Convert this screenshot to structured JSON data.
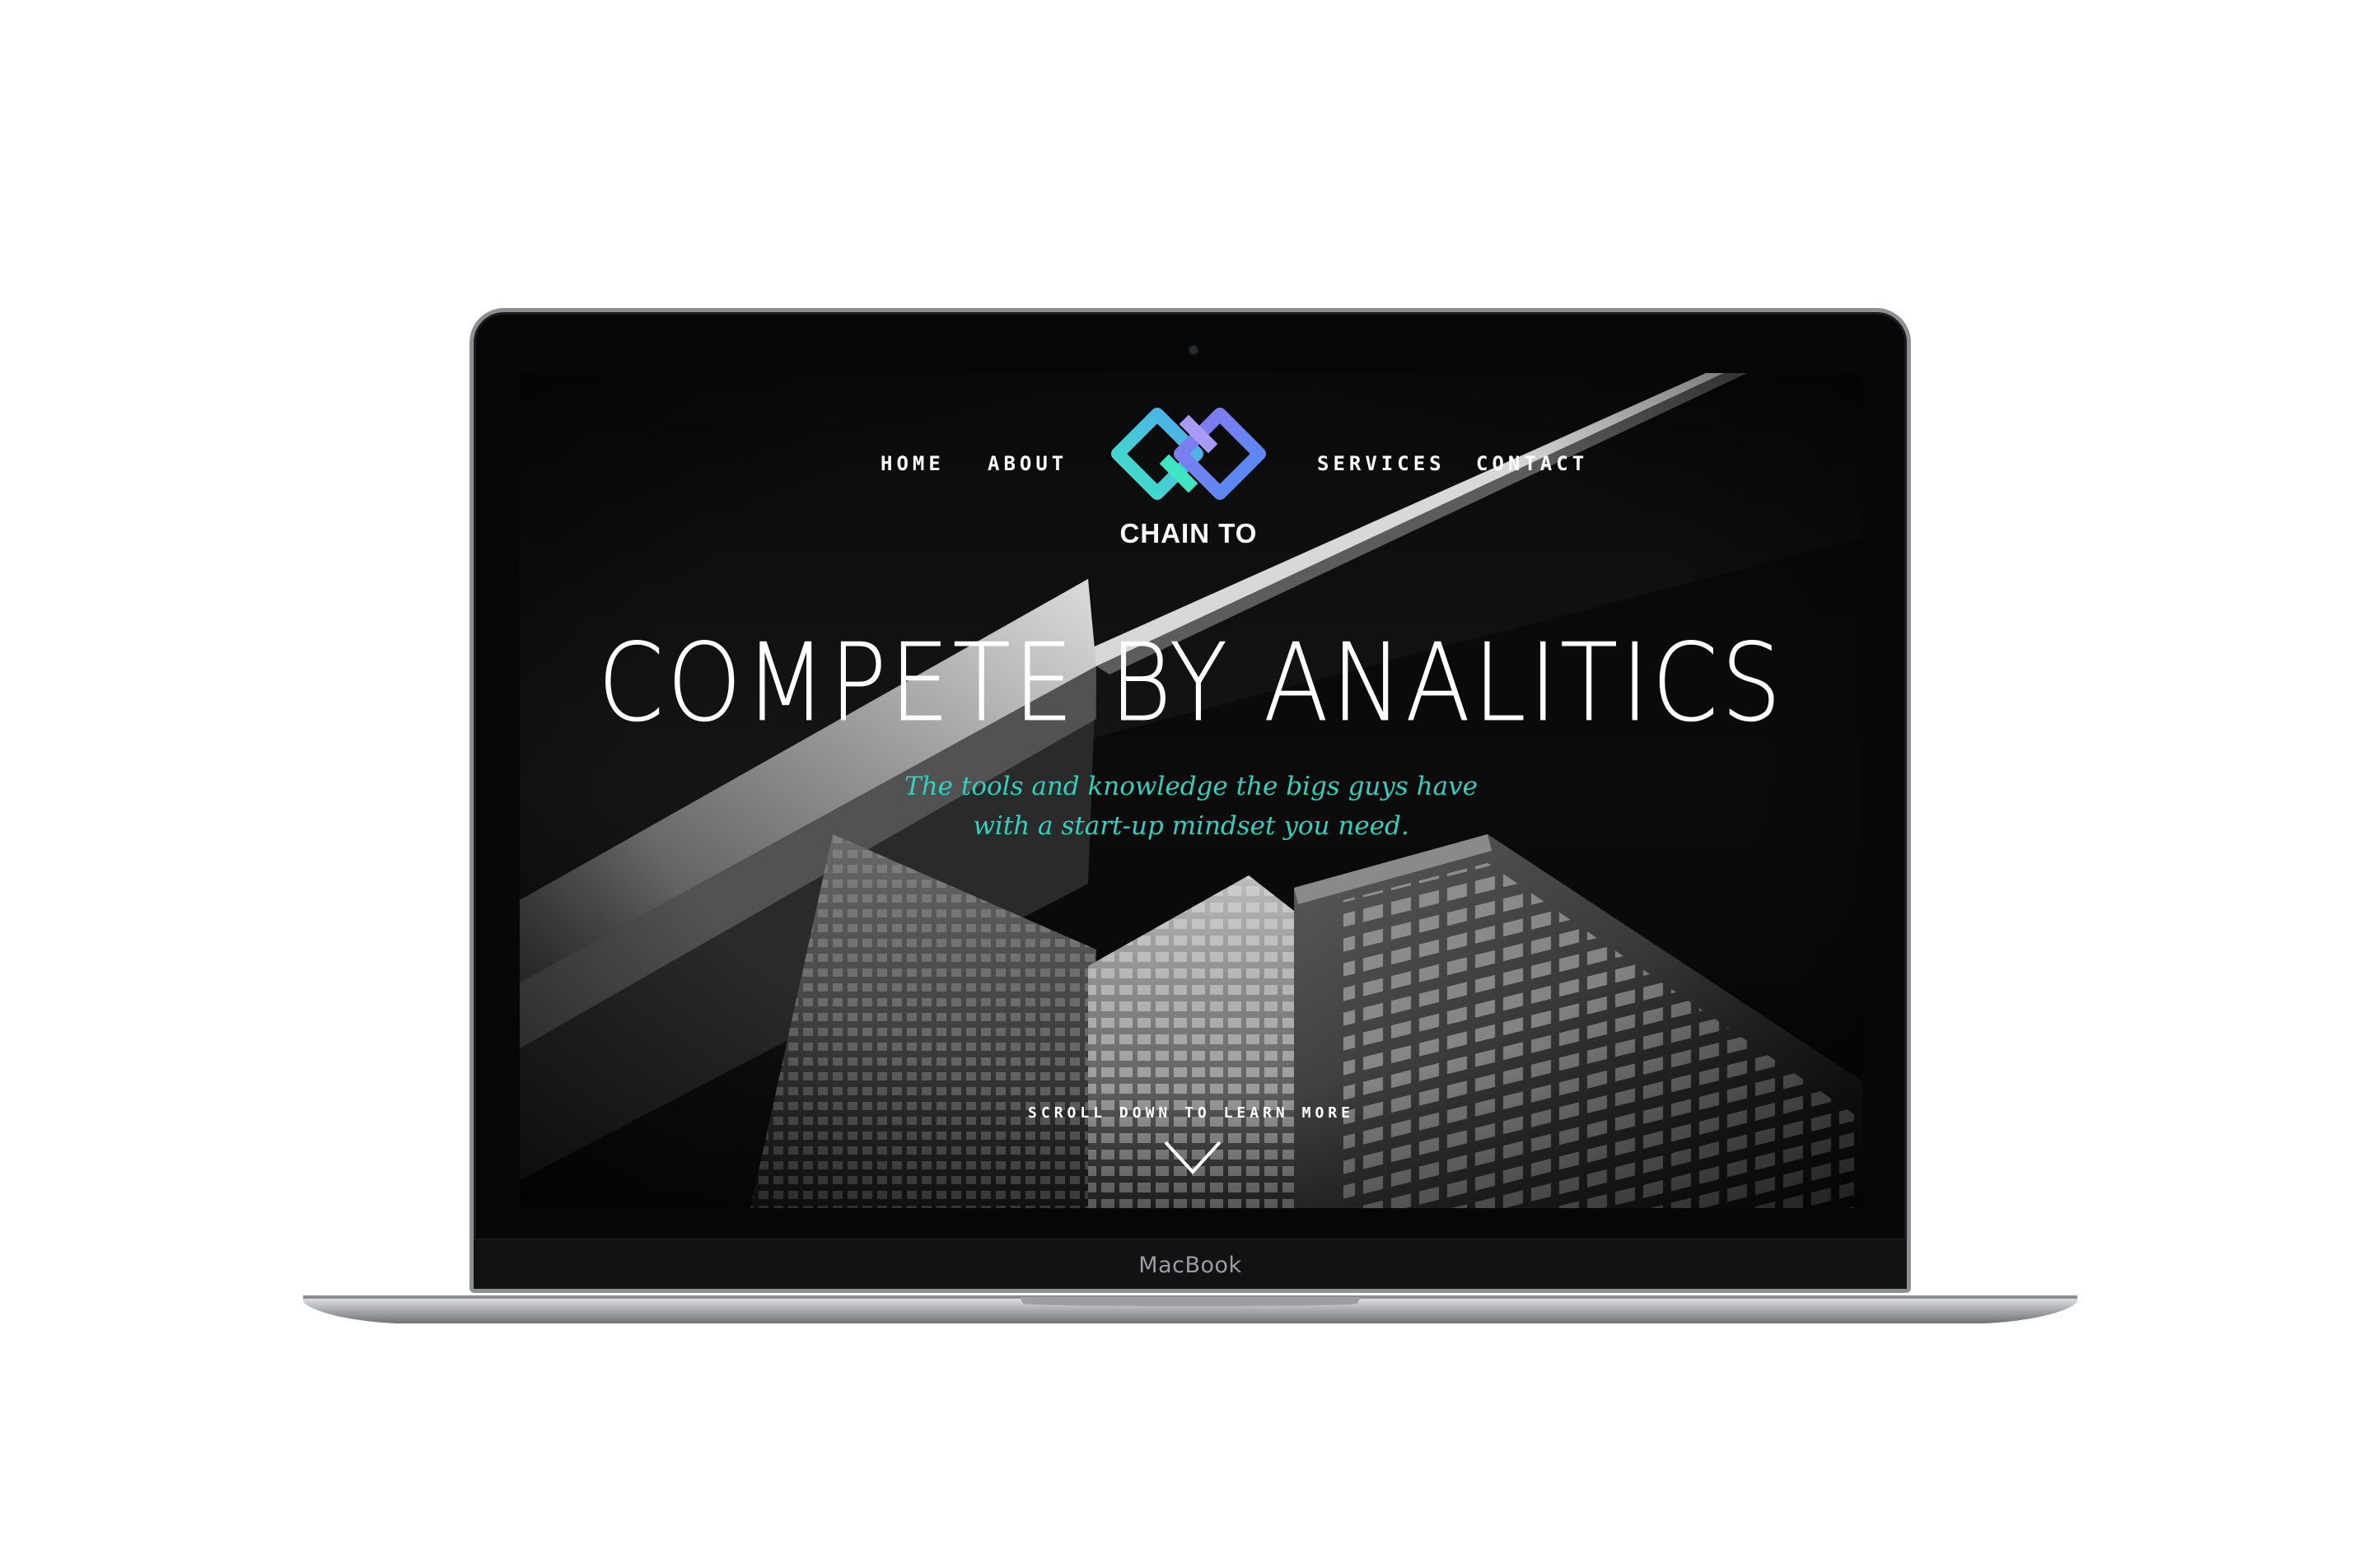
{
  "device": {
    "brand_label": "MacBook"
  },
  "nav": {
    "items": [
      {
        "label": "HOME"
      },
      {
        "label": "ABOUT"
      },
      {
        "label": "SERVICES"
      },
      {
        "label": "CONTACT"
      }
    ]
  },
  "logo": {
    "text": "CHAIN TO",
    "icon": "chain-link-logo",
    "colors": [
      "#3ee6c4",
      "#4f8cf2",
      "#8a79f0"
    ]
  },
  "hero": {
    "headline": "COMPETE BY ANALITICS",
    "subline_1": "The tools and knowledge the bigs guys have",
    "subline_2": "with a start-up mindset you need.",
    "scroll_text": "SCROLL DOWN TO LEARN MORE",
    "scroll_icon": "chevron-down-icon"
  },
  "colors": {
    "accent": "#2fd1c0",
    "background": "#050505"
  }
}
